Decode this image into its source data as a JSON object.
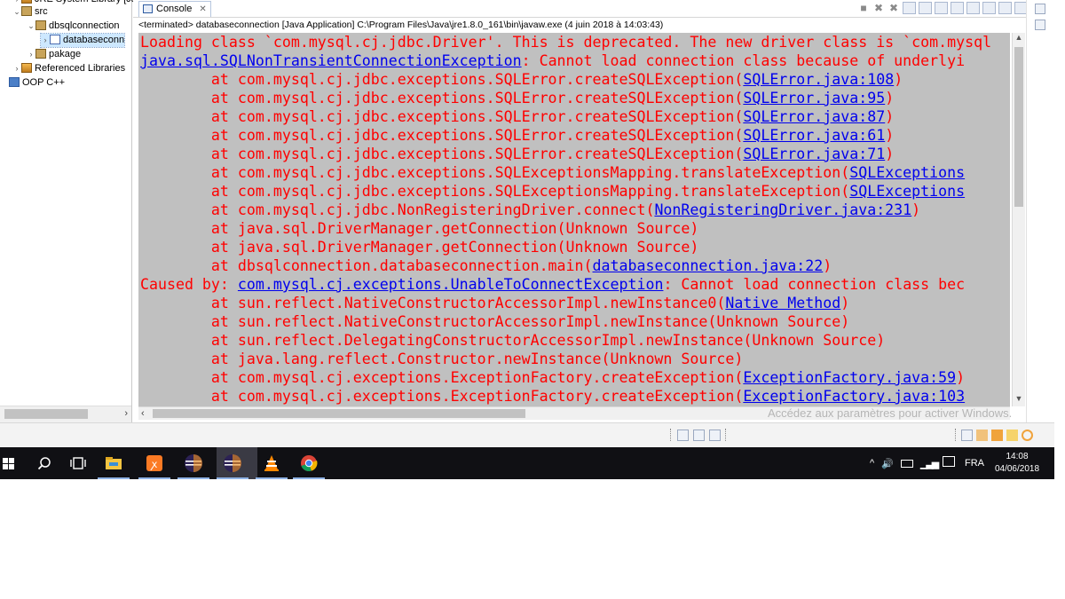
{
  "explorer": {
    "items": [
      {
        "label": "JRE System Library [Ja",
        "icon": "library-icon",
        "expander": "collapsed"
      },
      {
        "label": "src",
        "icon": "source-folder-icon",
        "expander": "expanded"
      },
      {
        "label": "dbsqlconnection",
        "icon": "package-icon",
        "expander": "expanded"
      },
      {
        "label": "databaseconn",
        "icon": "java-file-icon",
        "expander": "collapsed"
      },
      {
        "label": "pakage",
        "icon": "package-icon",
        "expander": "collapsed"
      },
      {
        "label": "Referenced Libraries",
        "icon": "library-icon",
        "expander": "collapsed"
      },
      {
        "label": "OOP C++",
        "icon": "project-icon",
        "expander": "none"
      }
    ],
    "hscroll_right": "›"
  },
  "console": {
    "tab_label": "Console",
    "tab_close": "✕",
    "description": "<terminated> databaseconnection [Java Application] C:\\Program Files\\Java\\jre1.8.0_161\\bin\\javaw.exe (4 juin 2018 à 14:03:43)",
    "lines": [
      {
        "parts": [
          {
            "t": "Loading class `com.mysql.cj.jdbc.Driver'. This is deprecated. The new driver class is `com.mysql"
          }
        ]
      },
      {
        "parts": [
          {
            "t": "java.sql.SQLNonTransientConnectionException",
            "link": true
          },
          {
            "t": ": Cannot load connection class because of underlyi"
          }
        ]
      },
      {
        "parts": [
          {
            "t": "\tat com.mysql.cj.jdbc.exceptions.SQLError.createSQLException("
          },
          {
            "t": "SQLError.java:108",
            "link": true
          },
          {
            "t": ")"
          }
        ]
      },
      {
        "parts": [
          {
            "t": "\tat com.mysql.cj.jdbc.exceptions.SQLError.createSQLException("
          },
          {
            "t": "SQLError.java:95",
            "link": true
          },
          {
            "t": ")"
          }
        ]
      },
      {
        "parts": [
          {
            "t": "\tat com.mysql.cj.jdbc.exceptions.SQLError.createSQLException("
          },
          {
            "t": "SQLError.java:87",
            "link": true
          },
          {
            "t": ")"
          }
        ]
      },
      {
        "parts": [
          {
            "t": "\tat com.mysql.cj.jdbc.exceptions.SQLError.createSQLException("
          },
          {
            "t": "SQLError.java:61",
            "link": true
          },
          {
            "t": ")"
          }
        ]
      },
      {
        "parts": [
          {
            "t": "\tat com.mysql.cj.jdbc.exceptions.SQLError.createSQLException("
          },
          {
            "t": "SQLError.java:71",
            "link": true
          },
          {
            "t": ")"
          }
        ]
      },
      {
        "parts": [
          {
            "t": "\tat com.mysql.cj.jdbc.exceptions.SQLExceptionsMapping.translateException("
          },
          {
            "t": "SQLExceptions",
            "link": true
          }
        ]
      },
      {
        "parts": [
          {
            "t": "\tat com.mysql.cj.jdbc.exceptions.SQLExceptionsMapping.translateException("
          },
          {
            "t": "SQLExceptions",
            "link": true
          }
        ]
      },
      {
        "parts": [
          {
            "t": "\tat com.mysql.cj.jdbc.NonRegisteringDriver.connect("
          },
          {
            "t": "NonRegisteringDriver.java:231",
            "link": true
          },
          {
            "t": ")"
          }
        ]
      },
      {
        "parts": [
          {
            "t": "\tat java.sql.DriverManager.getConnection(Unknown Source)"
          }
        ]
      },
      {
        "parts": [
          {
            "t": "\tat java.sql.DriverManager.getConnection(Unknown Source)"
          }
        ]
      },
      {
        "parts": [
          {
            "t": "\tat dbsqlconnection.databaseconnection.main("
          },
          {
            "t": "databaseconnection.java:22",
            "link": true
          },
          {
            "t": ")"
          }
        ]
      },
      {
        "parts": [
          {
            "t": "Caused by: "
          },
          {
            "t": "com.mysql.cj.exceptions.UnableToConnectException",
            "link": true
          },
          {
            "t": ": Cannot load connection class bec"
          }
        ]
      },
      {
        "parts": [
          {
            "t": "\tat sun.reflect.NativeConstructorAccessorImpl.newInstance0("
          },
          {
            "t": "Native Method",
            "link": true
          },
          {
            "t": ")"
          }
        ]
      },
      {
        "parts": [
          {
            "t": "\tat sun.reflect.NativeConstructorAccessorImpl.newInstance(Unknown Source)"
          }
        ]
      },
      {
        "parts": [
          {
            "t": "\tat sun.reflect.DelegatingConstructorAccessorImpl.newInstance(Unknown Source)"
          }
        ]
      },
      {
        "parts": [
          {
            "t": "\tat java.lang.reflect.Constructor.newInstance(Unknown Source)"
          }
        ]
      },
      {
        "parts": [
          {
            "t": "\tat com.mysql.cj.exceptions.ExceptionFactory.createException("
          },
          {
            "t": "ExceptionFactory.java:59",
            "link": true
          },
          {
            "t": ")"
          }
        ]
      },
      {
        "parts": [
          {
            "t": "\tat com.mysql.cj.exceptions.ExceptionFactory.createException("
          },
          {
            "t": "ExceptionFactory.java:103",
            "link": true
          }
        ]
      }
    ],
    "scroll_up": "▲",
    "scroll_down": "▼",
    "hscroll_left": "‹",
    "watermark": "Accédez aux paramètres pour activer Windows."
  },
  "taskbar": {
    "apps": [
      "search-icon",
      "task-view-icon",
      "file-explorer-icon",
      "xampp-icon",
      "eclipse-icon",
      "eclipse-icon",
      "vlc-icon",
      "chrome-icon"
    ],
    "tray_arrow": "^",
    "language": "FRA",
    "time": "14:08",
    "date": "04/06/2018"
  },
  "colors": {
    "console_bg": "#c0c0c0",
    "error_text": "#ff0000",
    "link_text": "#0000ee",
    "taskbar_bg": "#101014"
  }
}
